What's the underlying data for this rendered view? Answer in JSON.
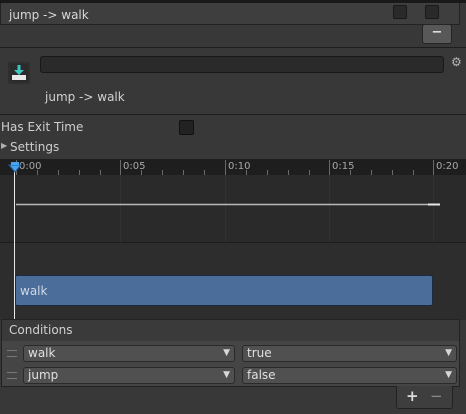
{
  "header": {
    "title": "jump -> walk",
    "minus_label": "−"
  },
  "transition": {
    "name_value": "",
    "subtitle": "jump -> walk",
    "settings_icon": "gear-icon",
    "type_icon": "transition-icon"
  },
  "settings": {
    "has_exit_time_label": "Has Exit Time",
    "has_exit_time": false,
    "settings_label": "Settings"
  },
  "timeline": {
    "ticks": [
      "0:00",
      "0:05",
      "0:10",
      "0:15",
      "0:20"
    ],
    "clip_label": "walk"
  },
  "conditions": {
    "header": "Conditions",
    "rows": [
      {
        "param": "walk",
        "value": "true"
      },
      {
        "param": "jump",
        "value": "false"
      }
    ],
    "add_label": "+",
    "remove_label": "−"
  }
}
